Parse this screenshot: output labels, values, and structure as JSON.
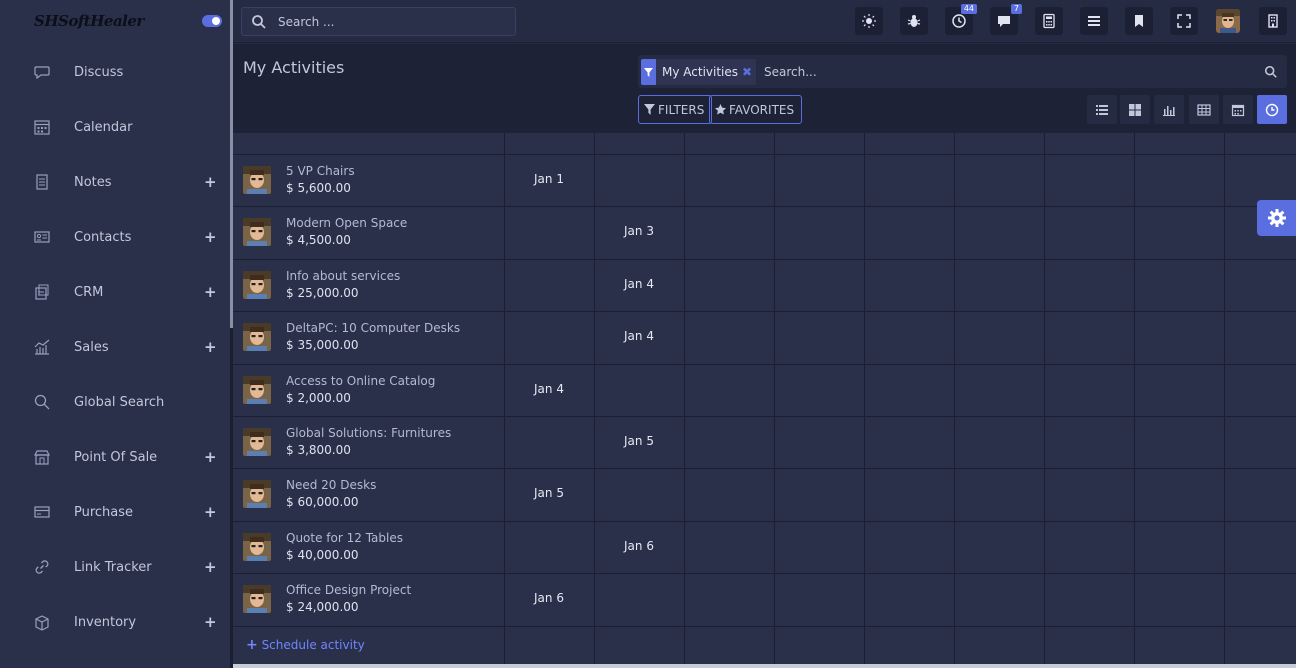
{
  "sidebar": {
    "brand": "SHSoftHealer",
    "items": [
      {
        "label": "Discuss",
        "icon": "chat-bubble-icon",
        "plus": ""
      },
      {
        "label": "Calendar",
        "icon": "calendar-icon",
        "plus": ""
      },
      {
        "label": "Notes",
        "icon": "notes-icon",
        "plus": "+"
      },
      {
        "label": "Contacts",
        "icon": "contact-card-icon",
        "plus": "+"
      },
      {
        "label": "CRM",
        "icon": "crm-icon",
        "plus": "+"
      },
      {
        "label": "Sales",
        "icon": "sales-chart-icon",
        "plus": "+"
      },
      {
        "label": "Global Search",
        "icon": "search-icon",
        "plus": ""
      },
      {
        "label": "Point Of Sale",
        "icon": "store-icon",
        "plus": "+"
      },
      {
        "label": "Purchase",
        "icon": "credit-card-icon",
        "plus": "+"
      },
      {
        "label": "Link Tracker",
        "icon": "link-icon",
        "plus": "+"
      },
      {
        "label": "Inventory",
        "icon": "box-icon",
        "plus": "+"
      }
    ]
  },
  "topbar": {
    "search_placeholder": "Search ...",
    "activity_badge": "44",
    "messages_badge": "7"
  },
  "control_panel": {
    "title": "My Activities",
    "facet_label": "My Activities",
    "facet_close": "✖",
    "search_placeholder": "Search...",
    "filters_label": "FILTERS",
    "favorites_label": "FAVORITES"
  },
  "activities": [
    {
      "title": "5 VP Chairs",
      "amount": "$ 5,600.00",
      "date": "Jan 1",
      "col": 0
    },
    {
      "title": "Modern Open Space",
      "amount": "$ 4,500.00",
      "date": "Jan 3",
      "col": 1
    },
    {
      "title": "Info about services",
      "amount": "$ 25,000.00",
      "date": "Jan 4",
      "col": 1
    },
    {
      "title": "DeltaPC: 10 Computer Desks",
      "amount": "$ 35,000.00",
      "date": "Jan 4",
      "col": 1
    },
    {
      "title": "Access to Online Catalog",
      "amount": "$ 2,000.00",
      "date": "Jan 4",
      "col": 0
    },
    {
      "title": "Global Solutions: Furnitures",
      "amount": "$ 3,800.00",
      "date": "Jan 5",
      "col": 1
    },
    {
      "title": "Need 20 Desks",
      "amount": "$ 60,000.00",
      "date": "Jan 5",
      "col": 0
    },
    {
      "title": "Quote for 12 Tables",
      "amount": "$ 40,000.00",
      "date": "Jan 6",
      "col": 1
    },
    {
      "title": "Office Design Project",
      "amount": "$ 24,000.00",
      "date": "Jan 6",
      "col": 0
    }
  ],
  "schedule_label": "Schedule activity",
  "colors": {
    "accent": "#5a6ee0",
    "bg": "#262b44",
    "sidebar": "#2a2f4a"
  }
}
